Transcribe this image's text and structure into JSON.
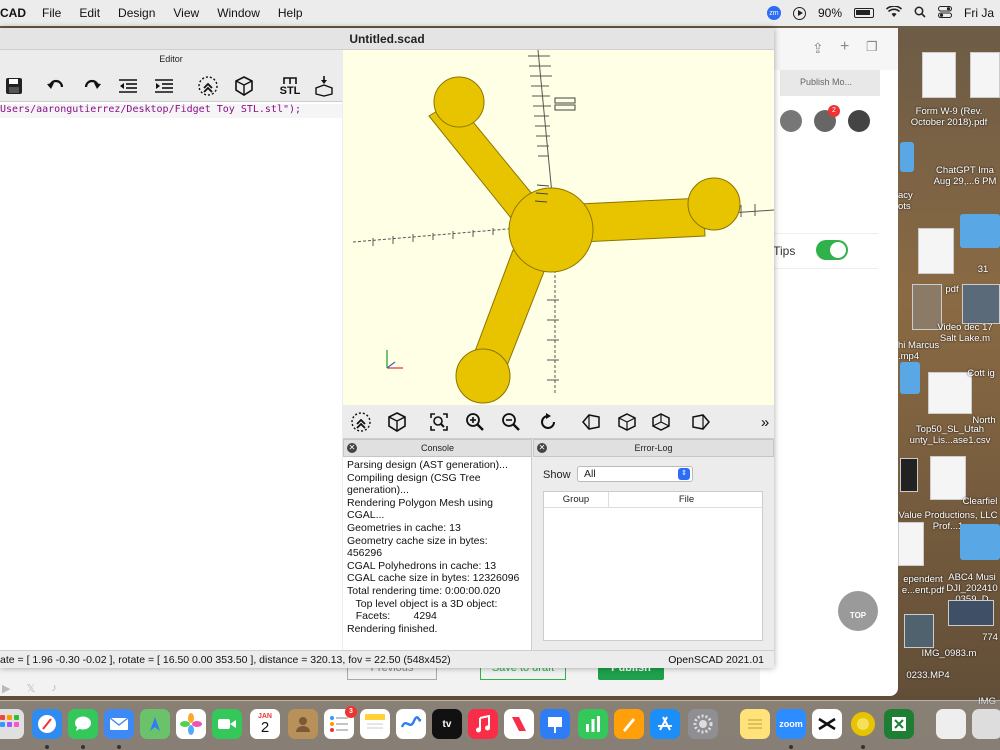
{
  "menubar": {
    "app": "CAD",
    "items": [
      "File",
      "Edit",
      "Design",
      "View",
      "Window",
      "Help"
    ],
    "zoom_icon_text": "zm",
    "battery": "90%",
    "clock": "Fri Ja"
  },
  "window": {
    "title": "Untitled.scad"
  },
  "editor": {
    "title": "Editor",
    "code_line": "Users/aarongutierrez/Desktop/Fidget Toy STL.stl\");",
    "stl_label": "STL"
  },
  "console": {
    "title": "Console",
    "lines": [
      "Parsing design (AST generation)...",
      "Compiling design (CSG Tree",
      "generation)...",
      "Rendering Polygon Mesh using",
      "CGAL...",
      "Geometries in cache: 13",
      "Geometry cache size in bytes:",
      "456296",
      "CGAL Polyhedrons in cache: 13",
      "CGAL cache size in bytes: 12326096",
      "Total rendering time: 0:00:00.020",
      "   Top level object is a 3D object:",
      "   Facets:        4294",
      "Rendering finished."
    ]
  },
  "errorlog": {
    "title": "Error-Log",
    "show_label": "Show",
    "show_value": "All",
    "col_group": "Group",
    "col_file": "File"
  },
  "status": {
    "camera": "ate = [ 1.96 -0.30 -0.02 ], rotate = [ 16.50 0.00 353.50 ], distance = 320.13, fov = 22.50 (548x452)",
    "version": "OpenSCAD 2021.01"
  },
  "viewport": {
    "model_color": "#e8c400",
    "background": "#ffffe5",
    "more": "»"
  },
  "browser": {
    "tab_label": "Publish Mo...",
    "mail_badge": "2",
    "tips_label": "pt Tips",
    "top_label": "TOP",
    "previous_label": "Previous",
    "save_draft_label": "Save to draft",
    "publish_label": "Publish"
  },
  "desktop": {
    "files": [
      {
        "label": "Form W-9 (Rev. October 2018).pdf"
      },
      {
        "label": "ChatGPT Ima Aug 29,...6 PM"
      },
      {
        "label": "acy ots"
      },
      {
        "label": "31"
      },
      {
        "label": "pdf"
      },
      {
        "label": "Video dec 17 Salt Lake.m"
      },
      {
        "label": "hi Marcus .mp4"
      },
      {
        "label": "Cott ig"
      },
      {
        "label": "North"
      },
      {
        "label": "Top50_SL_Utah unty_Lis...ase1.csv"
      },
      {
        "label": "Value Productions, LLC Prof...1"
      },
      {
        "label": "Clearfiel"
      },
      {
        "label": "ependent e...ent.pdf"
      },
      {
        "label": "ABC4 Musi DJI_202410 0359_D"
      },
      {
        "label": "774"
      },
      {
        "label": "IMG_0983.m"
      },
      {
        "label": "0233.MP4"
      },
      {
        "label": "IMG"
      }
    ]
  },
  "dock": {
    "calendar_month": "JAN",
    "calendar_day": "2",
    "reminders_badge": "3",
    "tv_label": "tv",
    "zoom_label": "zoom"
  },
  "social": [
    "▶",
    "𝕏",
    "♪"
  ]
}
